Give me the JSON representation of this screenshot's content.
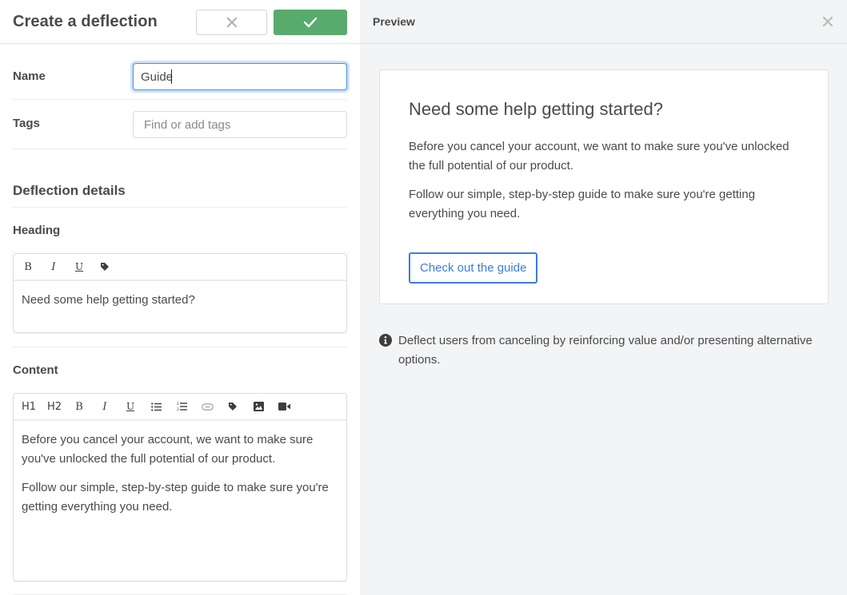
{
  "left_panel": {
    "title": "Create a deflection",
    "cancel_button": {
      "icon": "close-icon"
    },
    "save_button": {
      "icon": "check-icon",
      "color": "#58ab6d"
    },
    "name_field": {
      "label": "Name",
      "value": "Guide"
    },
    "tags_field": {
      "label": "Tags",
      "value": "",
      "placeholder": "Find or add tags"
    },
    "section_title": "Deflection details",
    "heading_editor": {
      "label": "Heading",
      "toolbar": [
        {
          "name": "bold",
          "glyph": "B"
        },
        {
          "name": "italic",
          "glyph": "I"
        },
        {
          "name": "underline",
          "glyph": "U"
        },
        {
          "name": "tag",
          "icon": "tag-icon"
        }
      ],
      "value": "Need some help getting started?"
    },
    "content_editor": {
      "label": "Content",
      "toolbar": [
        {
          "name": "h1",
          "glyph": "H1"
        },
        {
          "name": "h2",
          "glyph": "H2"
        },
        {
          "name": "bold",
          "glyph": "B"
        },
        {
          "name": "italic",
          "glyph": "I"
        },
        {
          "name": "underline",
          "glyph": "U"
        },
        {
          "name": "bullet-list",
          "icon": "bullet-list-icon"
        },
        {
          "name": "numbered-list",
          "icon": "numbered-list-icon"
        },
        {
          "name": "link",
          "icon": "link-icon"
        },
        {
          "name": "tag",
          "icon": "tag-icon"
        },
        {
          "name": "image",
          "icon": "image-icon"
        },
        {
          "name": "video",
          "icon": "video-icon"
        }
      ],
      "paragraphs": [
        "Before you cancel your account, we want to make sure you've unlocked the full potential of our product.",
        "Follow our simple, step-by-step guide to make sure you're getting everything you need."
      ]
    }
  },
  "preview_panel": {
    "title": "Preview",
    "close_icon": "close-icon",
    "card": {
      "heading": "Need some help getting started?",
      "paragraphs": [
        "Before you cancel your account, we want to make sure you've unlocked the full potential of our product.",
        "Follow our simple, step-by-step guide to make sure you're getting everything you need."
      ],
      "cta_label": "Check out the guide",
      "cta_color": "#3f7be0"
    },
    "info_note": "Deflect users from canceling by reinforcing value and/or presenting alternative options."
  }
}
